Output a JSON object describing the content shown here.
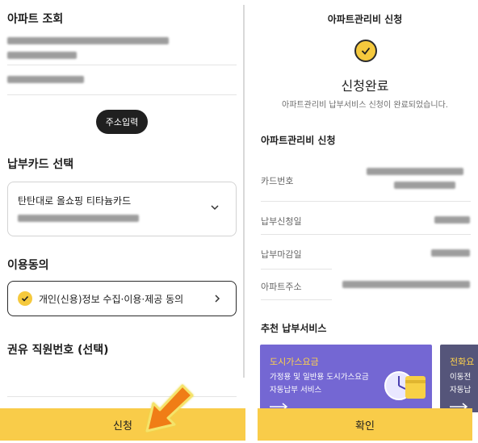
{
  "left": {
    "apt_lookup_title": "아파트 조회",
    "address_button": "주소입력",
    "card_select_title": "납부카드 선택",
    "selected_card_name": "탄탄대로 올쇼핑 티타늄카드",
    "consent_title": "이용동의",
    "consent_item": "개인(신용)정보 수집·이용·제공 동의",
    "recommender_title": "권유 직원번호 (선택)",
    "submit_button": "신청"
  },
  "right": {
    "page_title": "아파트관리비 신청",
    "done_title": "신청완료",
    "done_subtitle": "아파트관리비 납부서비스 신청이 완료되었습니다.",
    "section_title": "아파트관리비 신청",
    "rows": [
      {
        "label": "카드번호"
      },
      {
        "label": "납부신청일"
      },
      {
        "label": "납부마감일"
      },
      {
        "label": "아파트주소"
      }
    ],
    "recommend_title": "추천 납부서비스",
    "services": [
      {
        "title": "도시가스요금",
        "desc_line1": "가정용 및 일반용 도시가스요금",
        "desc_line2": "자동납부 서비스"
      },
      {
        "title": "전화요",
        "desc_line1": "이동전",
        "desc_line2": "자동납"
      }
    ],
    "confirm_button": "확인"
  },
  "colors": {
    "accent_yellow": "#f9cc49",
    "check_yellow": "#f5c93d",
    "annotation_orange": "#f07d14",
    "service_purple": "#7467d3",
    "service_dark": "#55557a"
  }
}
